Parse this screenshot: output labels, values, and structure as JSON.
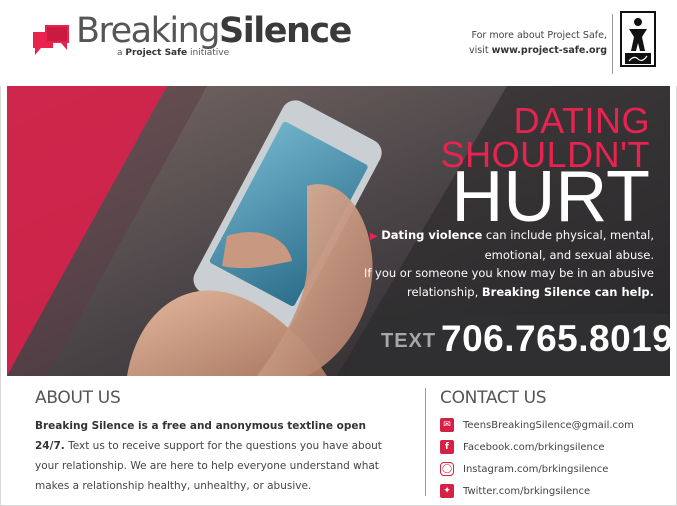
{
  "header": {
    "brand_light": "Breaking",
    "brand_bold": "Silence",
    "tagline_prefix": "a ",
    "tagline_bold": "Project Safe",
    "tagline_suffix": " initiative",
    "more_line1": "For more about Project Safe,",
    "more_line2_prefix": "visit ",
    "more_url": "www.project-safe.org",
    "partner_logo_icon": "project-safe-logo"
  },
  "hero": {
    "headline_line1": "DATING",
    "headline_line2": "SHOULDN'T",
    "headline_line3": "HURT",
    "bullet_bold": "Dating violence",
    "bullet_rest": " can include physical, mental, emotional, and sexual abuse.",
    "line2_prefix": "If you or someone you know may be in an abusive relationship, ",
    "line2_bold": "Breaking Silence can help.",
    "text_label": "TEXT",
    "text_number": "706.765.8019"
  },
  "about": {
    "heading": "ABOUT US",
    "lead_bold": "Breaking Silence is a free and anonymous textline open 24/7.",
    "body": "Text us to receive support for the questions you have about your relationship. We are here to help everyone understand what makes a relationship healthy, unhealthy, or abusive."
  },
  "contact": {
    "heading": "CONTACT US",
    "items": [
      {
        "icon": "mail-icon",
        "label": "TeensBreakingSilence@gmail.com"
      },
      {
        "icon": "facebook-icon",
        "label": "Facebook.com/brkingsilence"
      },
      {
        "icon": "instagram-icon",
        "label": "Instagram.com/brkingsilence"
      },
      {
        "icon": "twitter-icon",
        "label": "Twitter.com/brkingsilence"
      }
    ]
  },
  "colors": {
    "accent": "#e8234f",
    "dark": "#2b2a2c"
  }
}
